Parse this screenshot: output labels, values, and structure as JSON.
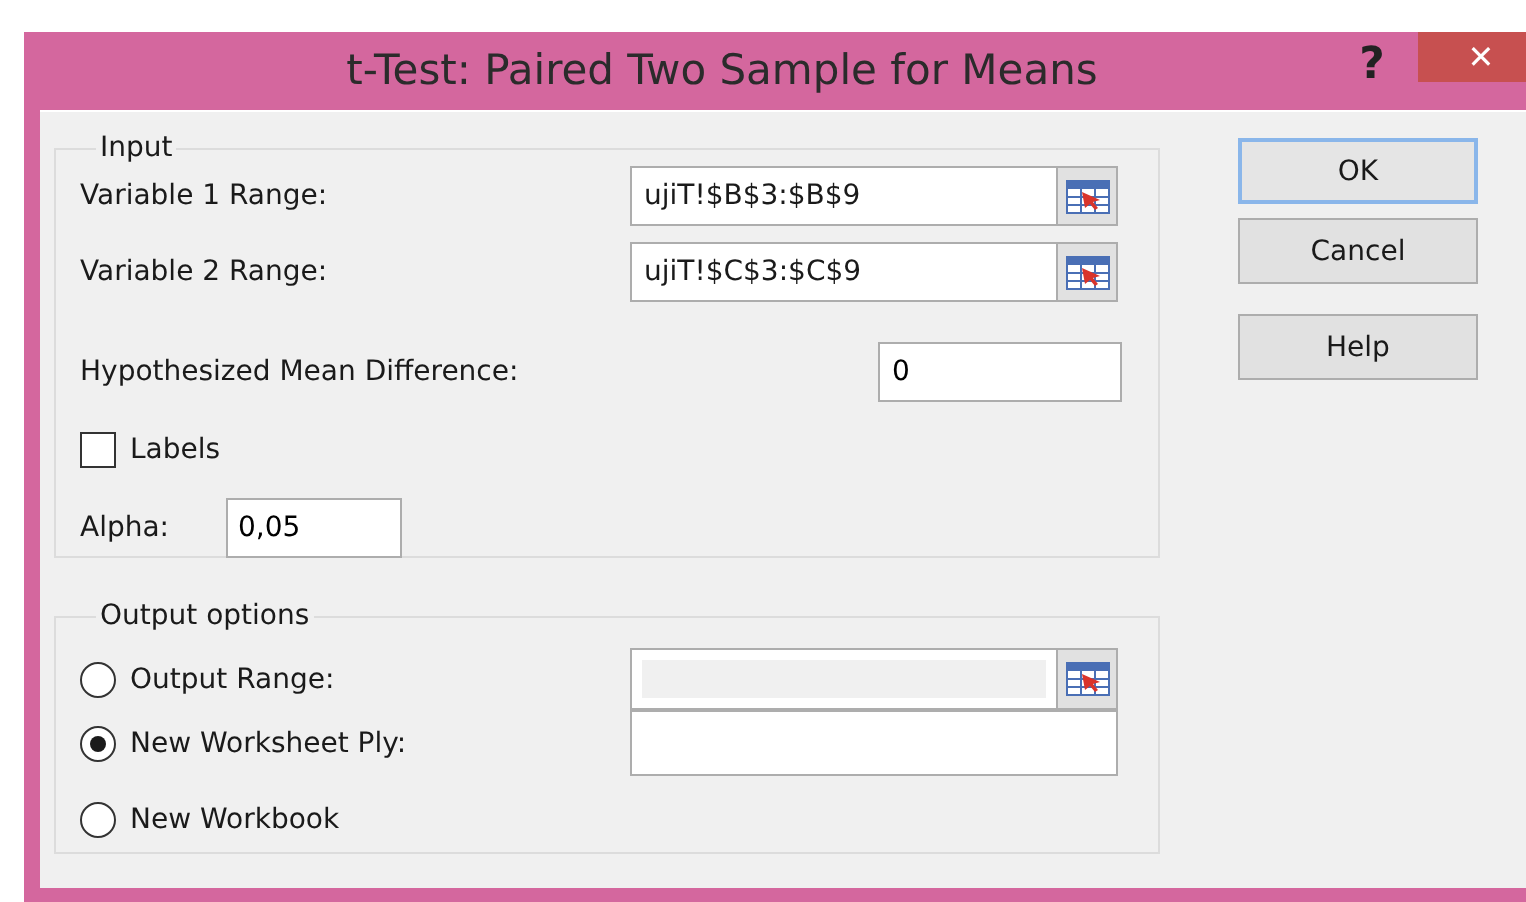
{
  "window": {
    "title": "t-Test: Paired Two Sample for Means",
    "help_glyph": "?",
    "close_glyph": "✕"
  },
  "input": {
    "legend": "Input",
    "ranges": [
      {
        "label": "Variable 1 Range:",
        "value": "ujiT!$B$3:$B$9"
      },
      {
        "label": "Variable 2 Range:",
        "value": "ujiT!$C$3:$C$9"
      }
    ],
    "hypothesized_mean_difference": {
      "label": "Hypothesized Mean Difference:",
      "value": "0"
    },
    "labels": {
      "label": "Labels",
      "checked": false
    },
    "alpha": {
      "label": "Alpha:",
      "value": "0,05"
    }
  },
  "output": {
    "legend": "Output options",
    "options": [
      {
        "label": "Output Range:",
        "selected": false,
        "kind": "range",
        "disabled": true
      },
      {
        "label": "New Worksheet Ply:",
        "selected": true,
        "kind": "text"
      },
      {
        "label": "New Workbook",
        "selected": false,
        "kind": "plain"
      }
    ]
  },
  "buttons": [
    {
      "label": "OK",
      "default": true
    },
    {
      "label": "Cancel",
      "default": false
    },
    {
      "label": "Help",
      "default": false
    }
  ]
}
